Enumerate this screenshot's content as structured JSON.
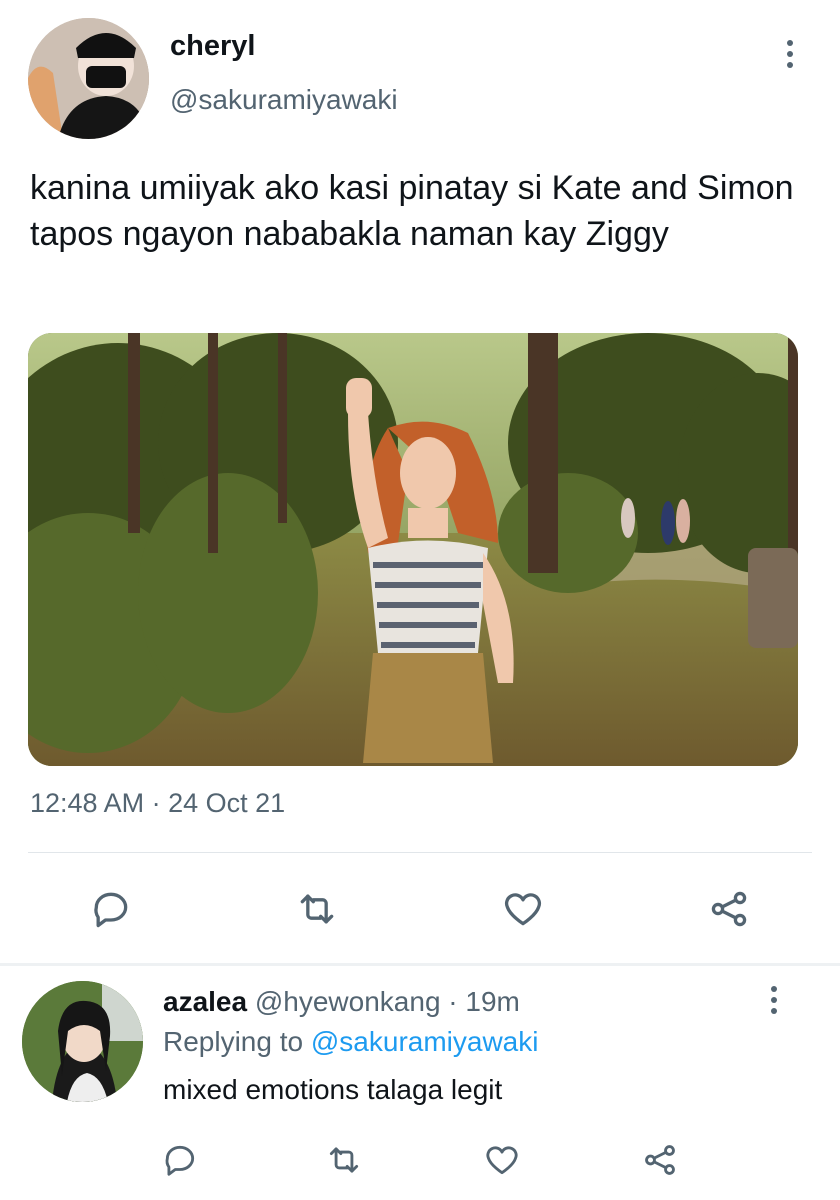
{
  "tweet": {
    "display_name": "cheryl",
    "handle": "@sakuramiyawaki",
    "text": "kanina umiiyak ako kasi pinatay si Kate and Simon tapos ngayon nababakla naman kay Ziggy",
    "timestamp": "12:48 AM · 24 Oct 21",
    "actions": [
      "reply-icon",
      "retweet-icon",
      "like-icon",
      "share-icon"
    ]
  },
  "reply": {
    "display_name": "azalea",
    "handle": "@hyewonkang",
    "age": "· 19m",
    "replying_prefix": "Replying to",
    "replying_to": "@sakuramiyawaki",
    "text": "mixed emotions talaga legit"
  },
  "colors": {
    "secondary_text": "#536471",
    "link": "#1d9bf0",
    "divider": "#e1e6ea"
  }
}
